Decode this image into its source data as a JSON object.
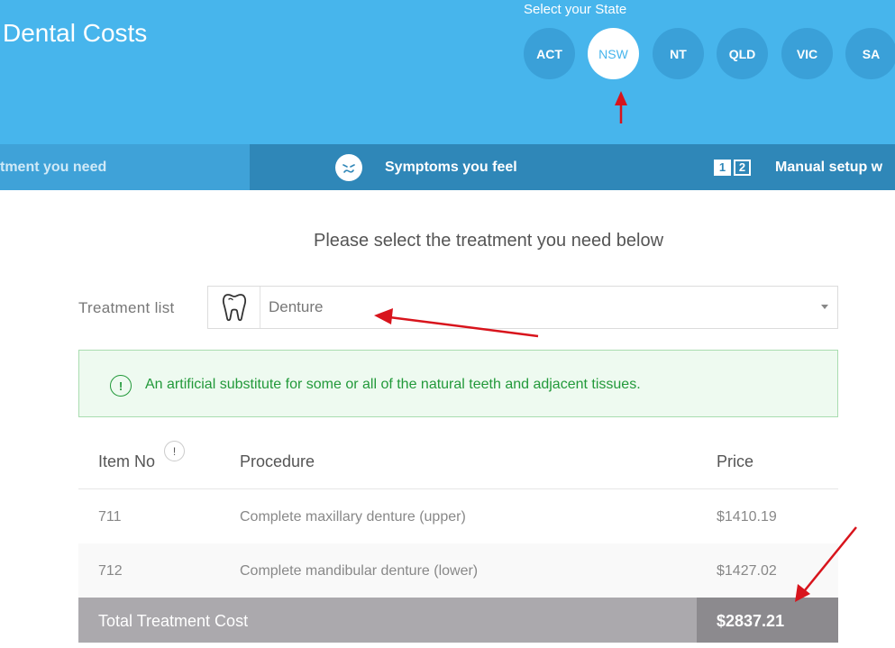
{
  "header": {
    "title": "Dental Costs",
    "state_label": "Select your State",
    "states": [
      "ACT",
      "NSW",
      "NT",
      "QLD",
      "VIC",
      "SA"
    ],
    "selected_state": "NSW"
  },
  "tabs": [
    {
      "label": "tment you need",
      "icon": "tooth-icon"
    },
    {
      "label": "Symptoms you feel",
      "icon": "face-icon"
    },
    {
      "label": "Manual setup w",
      "icon": "numbers-icon",
      "badge_1": "1",
      "badge_2": "2"
    }
  ],
  "main": {
    "subtitle": "Please select the treatment you need below",
    "treatment_label": "Treatment list",
    "treatment_selected": "Denture",
    "info_icon": "!",
    "description": "An artificial substitute for some or all of the natural teeth and adjacent tissues."
  },
  "table": {
    "headers": {
      "item": "Item No",
      "procedure": "Procedure",
      "price": "Price"
    },
    "help_icon": "!",
    "rows": [
      {
        "item": "711",
        "procedure": "Complete maxillary denture (upper)",
        "price": "$1410.19"
      },
      {
        "item": "712",
        "procedure": "Complete mandibular denture (lower)",
        "price": "$1427.02"
      }
    ],
    "total_label": "Total Treatment Cost",
    "total_value": "$2837.21"
  },
  "colors": {
    "header_blue": "#47b5ec",
    "tab_blue": "#2f87b8",
    "success_green": "#22993a",
    "total_gray": "#aba9ad",
    "annotation_red": "#d8141c"
  }
}
